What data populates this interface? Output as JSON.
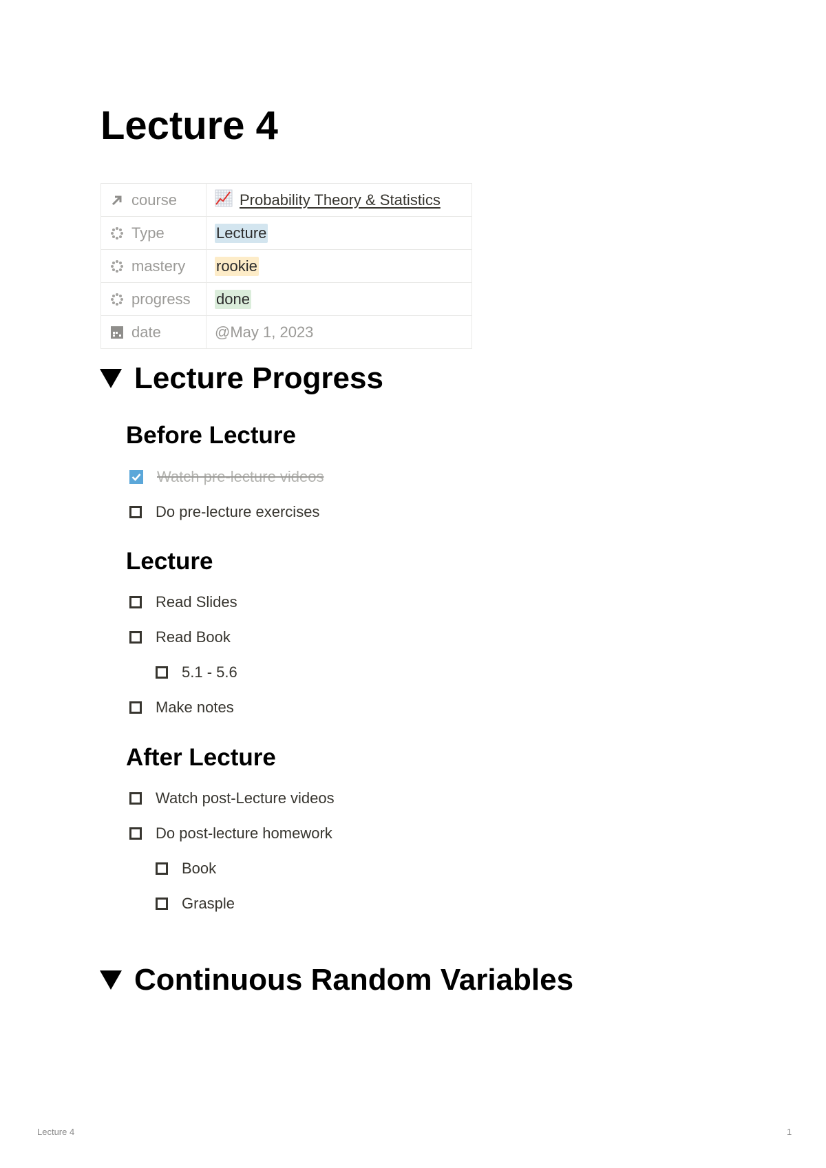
{
  "page": {
    "title": "Lecture 4"
  },
  "properties": [
    {
      "key": "course",
      "icon": "relation-arrow-icon",
      "value": "Probability Theory & Statistics",
      "value_icon": "chart-increasing-emoji-icon",
      "type": "relation"
    },
    {
      "key": "Type",
      "icon": "select-icon",
      "value": "Lecture",
      "type": "select",
      "color": "#d3e5ef"
    },
    {
      "key": "mastery",
      "icon": "select-icon",
      "value": "rookie",
      "type": "select",
      "color": "#fdecc8"
    },
    {
      "key": "progress",
      "icon": "select-icon",
      "value": "done",
      "type": "select",
      "color": "#dbeddb"
    },
    {
      "key": "date",
      "icon": "calendar-icon",
      "value": "@May 1, 2023",
      "type": "date"
    }
  ],
  "sections": [
    {
      "title": "Lecture Progress",
      "expanded": true,
      "groups": [
        {
          "heading": "Before Lecture",
          "todos": [
            {
              "label": "Watch pre-lecture videos",
              "checked": true
            },
            {
              "label": "Do pre-lecture exercises",
              "checked": false
            }
          ]
        },
        {
          "heading": "Lecture",
          "todos": [
            {
              "label": "Read Slides",
              "checked": false
            },
            {
              "label": "Read Book",
              "checked": false,
              "children": [
                {
                  "label": "5.1 - 5.6",
                  "checked": false
                }
              ]
            },
            {
              "label": "Make notes",
              "checked": false
            }
          ]
        },
        {
          "heading": "After Lecture",
          "todos": [
            {
              "label": "Watch post-Lecture videos",
              "checked": false
            },
            {
              "label": "Do post-lecture homework",
              "checked": false,
              "children": [
                {
                  "label": "Book",
                  "checked": false
                },
                {
                  "label": "Grasple",
                  "checked": false
                }
              ]
            }
          ]
        }
      ]
    },
    {
      "title": "Continuous Random Variables",
      "expanded": true
    }
  ],
  "footer": {
    "doc_title": "Lecture 4",
    "page_number": "1"
  },
  "colors": {
    "checkbox_checked": "#5ba7d9",
    "property_label": "#9b9a97",
    "text": "#37352f"
  }
}
